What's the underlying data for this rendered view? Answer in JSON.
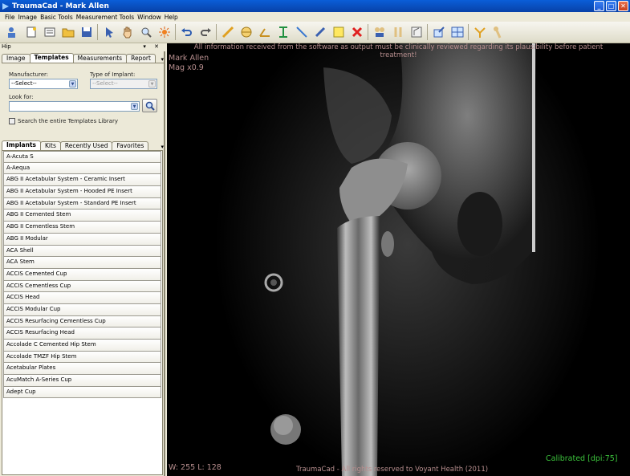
{
  "window": {
    "title": "TraumaCad - Mark Allen",
    "buttons": [
      "_",
      "□",
      "✕"
    ]
  },
  "menu": [
    "File",
    "Image",
    "Basic Tools",
    "Measurement Tools",
    "Window",
    "Help"
  ],
  "toolbar": {
    "icons": [
      "patient-icon",
      "new-icon",
      "list-icon",
      "open-folder-icon",
      "save-icon",
      "pointer-icon",
      "pan-hand-icon",
      "zoom-icon",
      "brightness-icon",
      "undo-icon",
      "redo-icon",
      "ruler-icon",
      "circle-icon",
      "angle-icon",
      "caliper-icon",
      "line-icon",
      "pen-icon",
      "note-icon",
      "delete-icon",
      "hip-tool-icon",
      "knee-tool-icon",
      "template-tool-icon",
      "export-icon",
      "layout-icon",
      "pelvis-icon",
      "femur-icon"
    ]
  },
  "panel": {
    "header": "Hip",
    "header_controls": "▾ ✕",
    "tabs": [
      "Image",
      "Templates",
      "Measurements",
      "Report"
    ],
    "active_tab": "Templates",
    "manufacturer_label": "Manufacturer:",
    "manufacturer_value": "--Select--",
    "type_label": "Type of Implant:",
    "type_value": "--Select--",
    "look_for_label": "Look for:",
    "look_for_value": "",
    "search_all_label": "Search the entire Templates Library",
    "inner_tabs": [
      "Implants",
      "Kits",
      "Recently Used",
      "Favorites"
    ],
    "active_inner_tab": "Implants",
    "implants": [
      "A-Acuta S",
      "A-Aequa",
      "ABG II Acetabular System - Ceramic Insert",
      "ABG II Acetabular System - Hooded PE Insert",
      "ABG II Acetabular System - Standard PE Insert",
      "ABG II Cemented Stem",
      "ABG II Cementless Stem",
      "ABG II Modular",
      "ACA Shell",
      "ACA Stem",
      "ACCIS Cemented Cup",
      "ACCIS Cementless Cup",
      "ACCIS Head",
      "ACCIS Modular Cup",
      "ACCIS Resurfacing Cementless Cup",
      "ACCIS Resurfacing Head",
      "Accolade C Cemented Hip Stem",
      "Accolade TMZF Hip Stem",
      "Acetabular Plates",
      "AcuMatch A-Series Cup",
      "Adept Cup"
    ]
  },
  "viewer": {
    "disclaimer_1": "All information received from the software as output must be clinically reviewed regarding its plausibility before patient",
    "disclaimer_2": "treatment!",
    "patient": "Mark Allen",
    "mag": "Mag x0.9",
    "window_level": "W: 255 L: 128",
    "copyright": "TraumaCad -  All rights reserved to Voyant Health  (2011)",
    "calibration": "Calibrated [dpi:75]"
  },
  "colors": {
    "overlay_text": "#b88f8f",
    "calibrated": "#3cc33c",
    "titlebar": "#0a5ed8"
  }
}
